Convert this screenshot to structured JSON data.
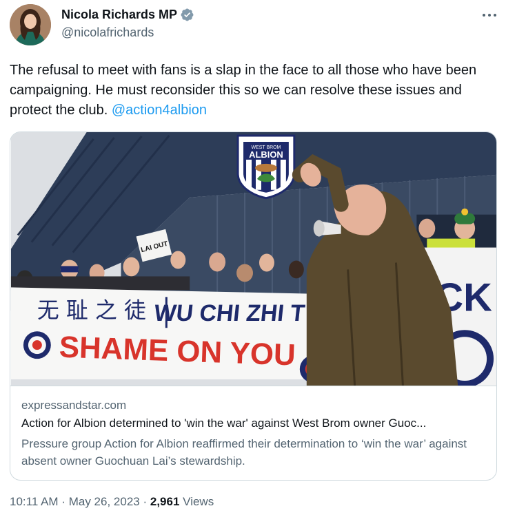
{
  "author": {
    "name": "Nicola Richards MP",
    "handle": "@nicolafrichards"
  },
  "tweet": {
    "text_main": "The refusal to meet with fans is a slap in the face to all those who have been campaigning. He must reconsider this so we can resolve these issues and protect the club. ",
    "mention": "@action4albion"
  },
  "card": {
    "domain": "expressandstar.com",
    "title": "Action for Albion determined to 'win the war' against West Brom owner Guoc...",
    "description": "Pressure group Action for Albion reaffirmed their determination to ‘win the war’ against absent owner Guochuan Lai’s stewardship.",
    "image": {
      "crest_top": "WEST BROM",
      "crest_name": "ALBION",
      "banner_chinese": "无 耻 之 徒",
      "banner_latin": "WU CHI ZHI T",
      "banner_slogan": "SHAME ON YOU",
      "placard": "LAI OUT",
      "right_banner": "ICK"
    }
  },
  "meta": {
    "time": "10:11 AM",
    "date": "May 26, 2023",
    "views_count": "2,961",
    "views_label": "Views",
    "separator": "·"
  },
  "icons": {
    "verified": "verified-badge-icon",
    "more": "more-options-icon"
  },
  "colors": {
    "link": "#1d9bf0",
    "secondary_text": "#536471",
    "primary_text": "#0f1419",
    "banner_red": "#d8342b",
    "banner_navy": "#1e2a6b"
  }
}
